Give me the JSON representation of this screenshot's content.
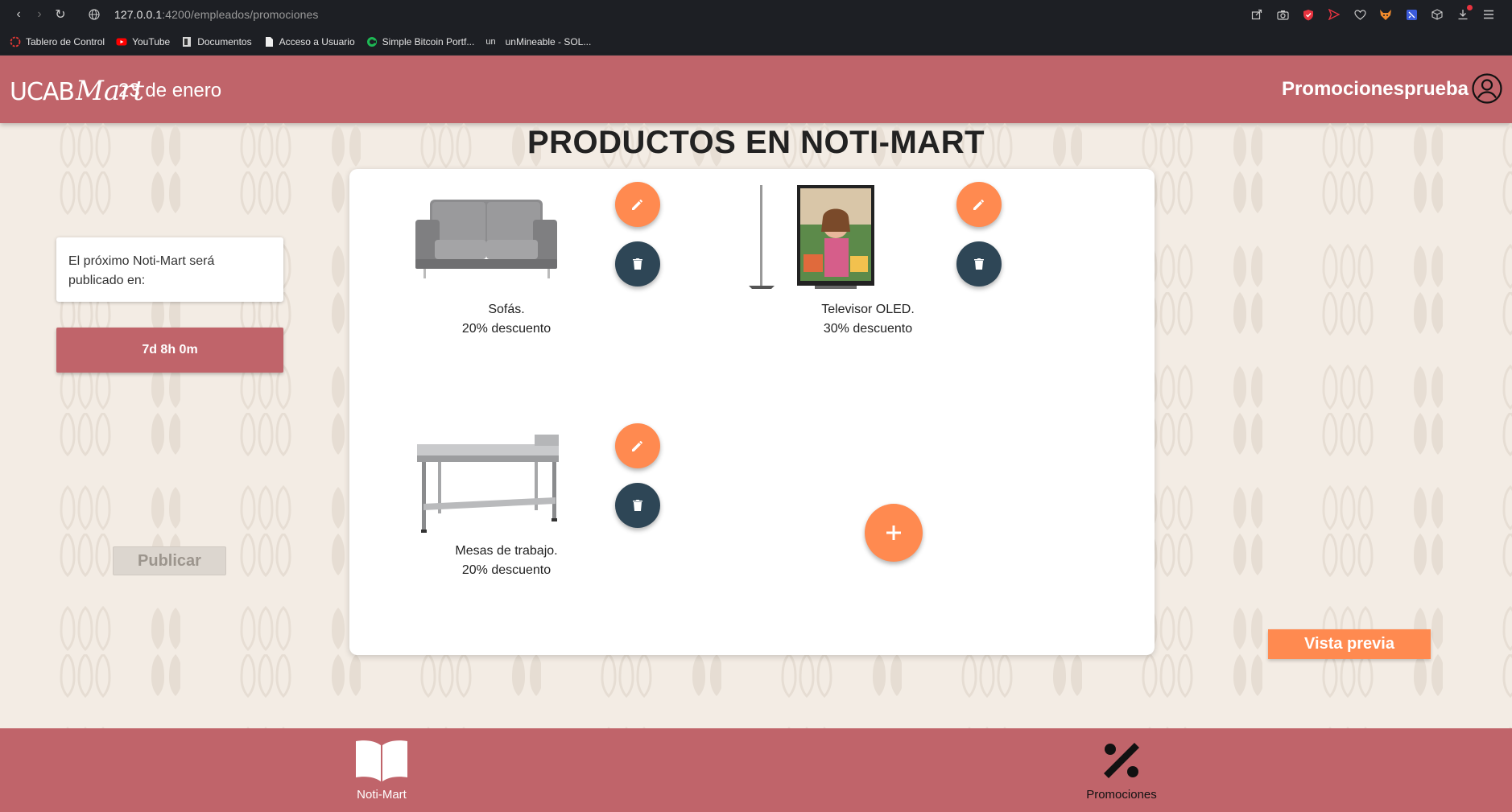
{
  "browser": {
    "url_host": "127.0.0.1",
    "url_rest": ":4200/empleados/promociones",
    "bookmarks": [
      {
        "label": "Tablero de Control",
        "color": "#e53935"
      },
      {
        "label": "YouTube",
        "color": "#ff0000"
      },
      {
        "label": "Documentos",
        "color": "#cccccc"
      },
      {
        "label": "Acceso a Usuario",
        "color": "#eeeeee"
      },
      {
        "label": "Simple Bitcoin Portf...",
        "color": "#1db954"
      },
      {
        "label": "unMineable - SOL...",
        "color": "#cccccc",
        "prefix": "un"
      }
    ]
  },
  "header": {
    "logo_ucab": "UCAB",
    "logo_mart": "Mart",
    "date": "23 de enero",
    "user": "Promocionesprueba"
  },
  "page_title": "PRODUCTOS EN NOTI-MART",
  "left_panel": {
    "next_text": "El próximo Noti-Mart será publicado en:",
    "countdown": "7d 8h 0m",
    "publish_label": "Publicar"
  },
  "products": [
    {
      "name": "Sofás.",
      "discount": "20% descuento",
      "icon": "sofa-image"
    },
    {
      "name": "Televisor OLED.",
      "discount": "30% descuento",
      "icon": "tv-image"
    },
    {
      "name": "Mesas de trabajo.",
      "discount": "20% descuento",
      "icon": "table-image"
    }
  ],
  "preview_label": "Vista previa",
  "bottom_nav": [
    {
      "label": "Noti-Mart",
      "icon": "book-icon"
    },
    {
      "label": "Promociones",
      "icon": "percent-icon"
    }
  ],
  "colors": {
    "brand": "#c0646a",
    "accent": "#ff8a50",
    "dark_button": "#2e4656",
    "background": "#f3ece4"
  }
}
